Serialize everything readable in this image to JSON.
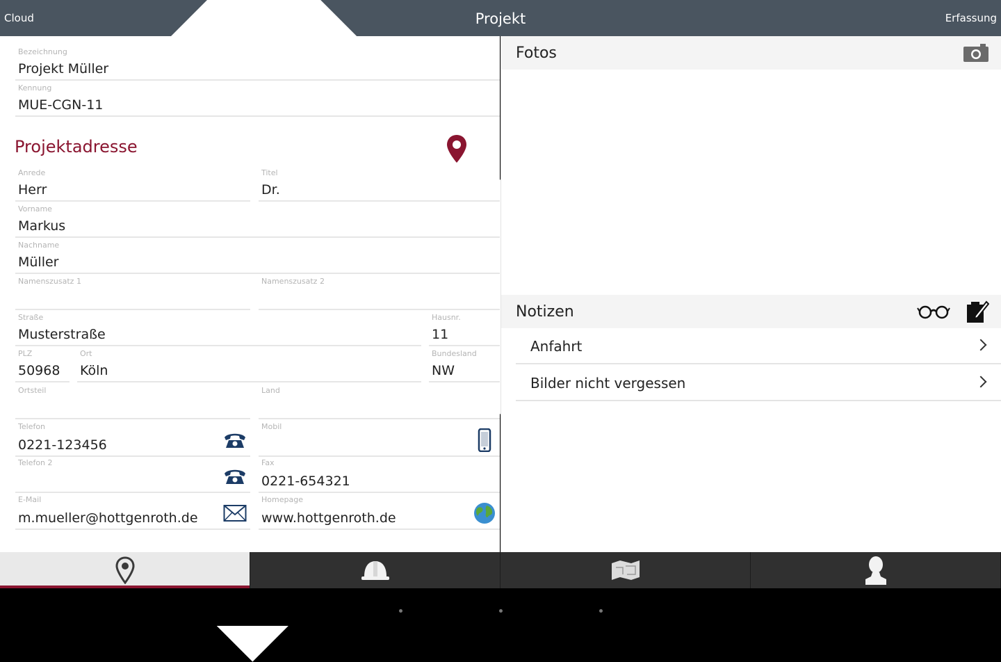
{
  "header": {
    "back_label": "Cloud",
    "title": "Projekt",
    "forward_label": "Erfassung"
  },
  "project": {
    "bezeichnung": {
      "label": "Bezeichnung",
      "value": "Projekt Müller"
    },
    "kennung": {
      "label": "Kennung",
      "value": "MUE-CGN-11"
    }
  },
  "address": {
    "section_title": "Projektadresse",
    "anrede": {
      "label": "Anrede",
      "value": "Herr"
    },
    "titel": {
      "label": "Titel",
      "value": "Dr."
    },
    "vorname": {
      "label": "Vorname",
      "value": "Markus"
    },
    "nachname": {
      "label": "Nachname",
      "value": "Müller"
    },
    "namenszusatz1": {
      "label": "Namenszusatz 1",
      "value": ""
    },
    "namenszusatz2": {
      "label": "Namenszusatz 2",
      "value": ""
    },
    "strasse": {
      "label": "Straße",
      "value": "Musterstraße"
    },
    "hausnr": {
      "label": "Hausnr.",
      "value": "11"
    },
    "plz": {
      "label": "PLZ",
      "value": "50968"
    },
    "ort": {
      "label": "Ort",
      "value": "Köln"
    },
    "bundesland": {
      "label": "Bundesland",
      "value": "NW"
    },
    "ortsteil": {
      "label": "Ortsteil",
      "value": ""
    },
    "land": {
      "label": "Land",
      "value": ""
    }
  },
  "contact": {
    "telefon": {
      "label": "Telefon",
      "value": "0221-123456"
    },
    "mobil": {
      "label": "Mobil",
      "value": ""
    },
    "telefon2": {
      "label": "Telefon 2",
      "value": ""
    },
    "fax": {
      "label": "Fax",
      "value": "0221-654321"
    },
    "email": {
      "label": "E-Mail",
      "value": "m.mueller@hottgenroth.de"
    },
    "homepage": {
      "label": "Homepage",
      "value": "www.hottgenroth.de"
    }
  },
  "fotos": {
    "title": "Fotos"
  },
  "notizen": {
    "title": "Notizen",
    "items": [
      {
        "label": "Anfahrt"
      },
      {
        "label": "Bilder nicht vergessen"
      }
    ]
  },
  "tabs": [
    {
      "icon": "location-pin-icon",
      "active": true
    },
    {
      "icon": "hard-hat-icon",
      "active": false
    },
    {
      "icon": "floor-plan-icon",
      "active": false
    },
    {
      "icon": "person-icon",
      "active": false
    }
  ],
  "colors": {
    "accent": "#8a1530",
    "header_bg": "#4a5560",
    "tabbar_bg": "#303030"
  }
}
